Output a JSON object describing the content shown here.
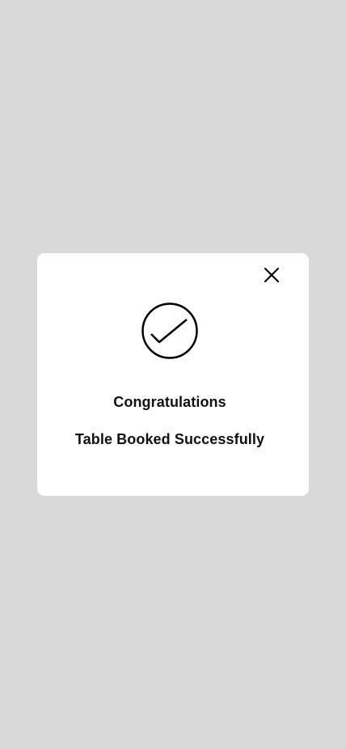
{
  "dialog": {
    "close_icon": "close-icon",
    "status_icon": "check-circle-icon",
    "title": "Congratulations",
    "message": "Table Booked Successfully"
  },
  "colors": {
    "backdrop": "#d9d9d9",
    "card": "#ffffff",
    "text": "#111111",
    "icon": "#000000"
  }
}
